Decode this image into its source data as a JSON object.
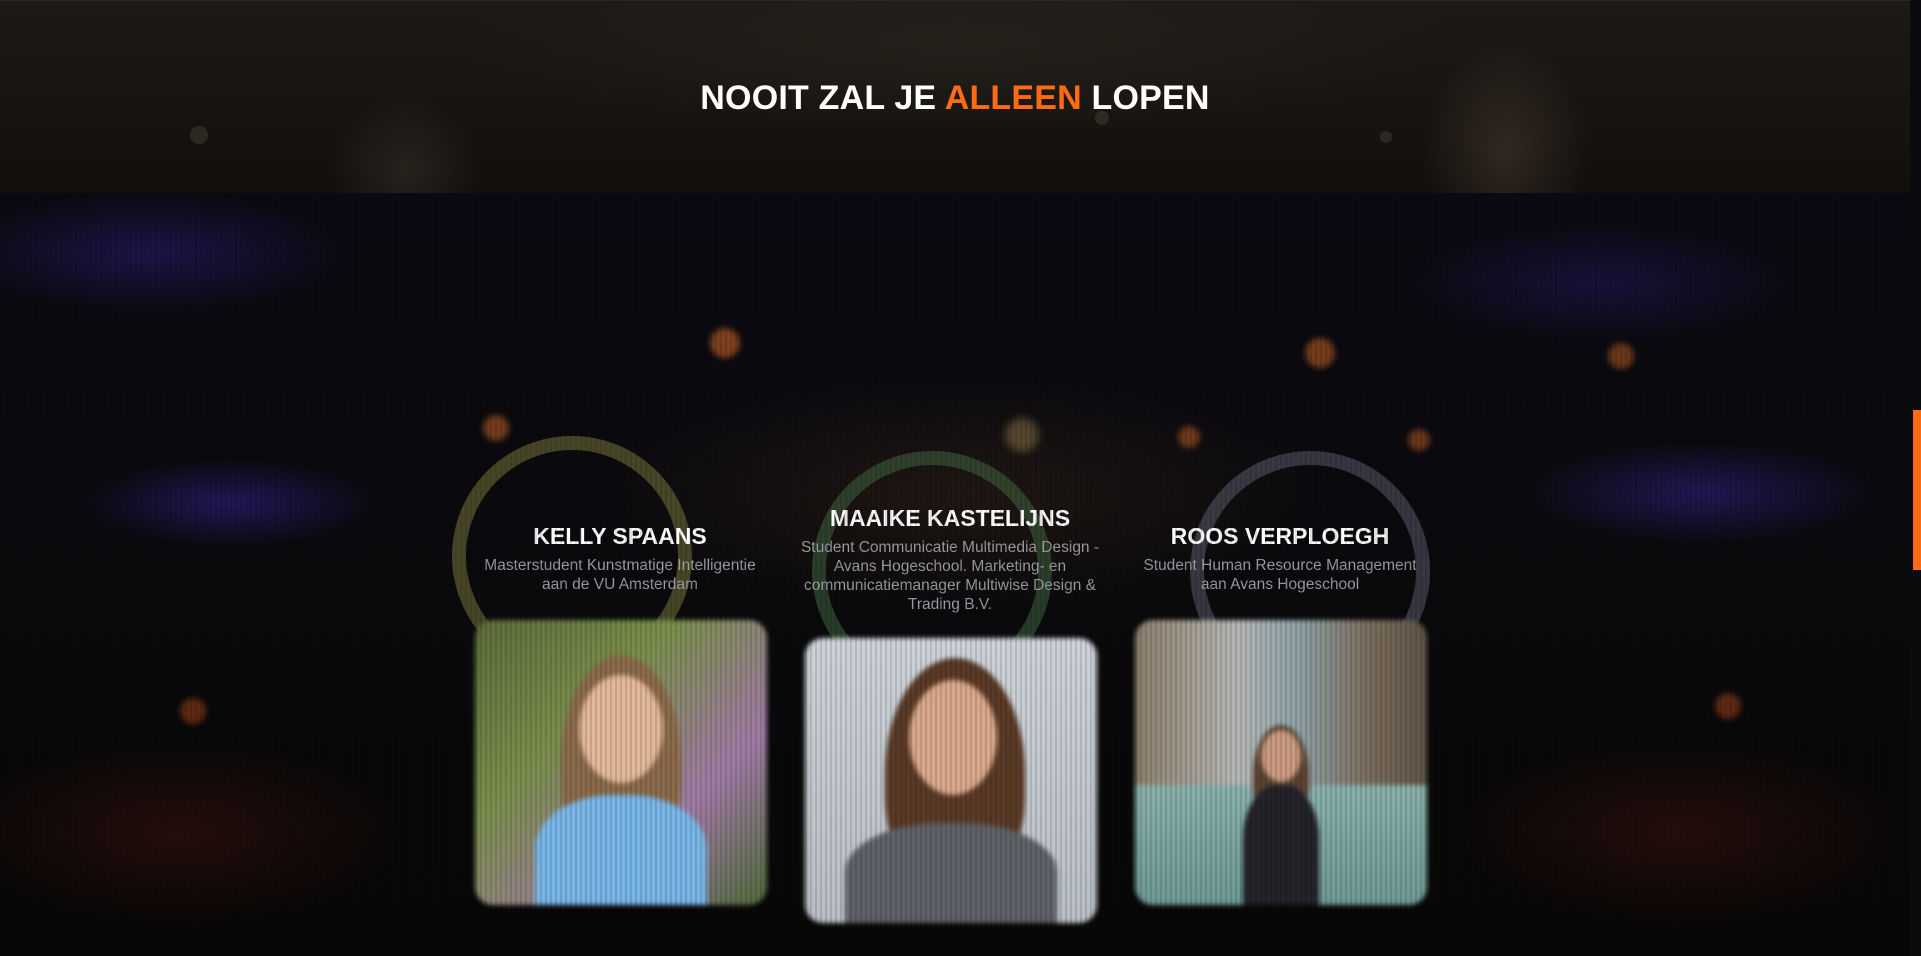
{
  "banner": {
    "title_part1": "NOOIT ZAL JE ",
    "title_accent": "ALLEEN",
    "title_part2": " LOPEN"
  },
  "team": {
    "members": [
      {
        "name": "KELLY SPAANS",
        "role": "Masterstudent Kunstmatige Intelligentie aan de VU Amsterdam"
      },
      {
        "name": "MAAIKE KASTELIJNS",
        "role": "Student Communicatie Multimedia Design - Avans Hogeschool. Marketing- en communicatiemanager Multiwise Design & Trading B.V."
      },
      {
        "name": "ROOS VERPLOEGH",
        "role": "Student Human Resource Management aan Avans Hogeschool"
      }
    ]
  },
  "colors": {
    "accent": "#ff6a13",
    "text": "#ffffff",
    "muted": "#9a9aa0"
  }
}
